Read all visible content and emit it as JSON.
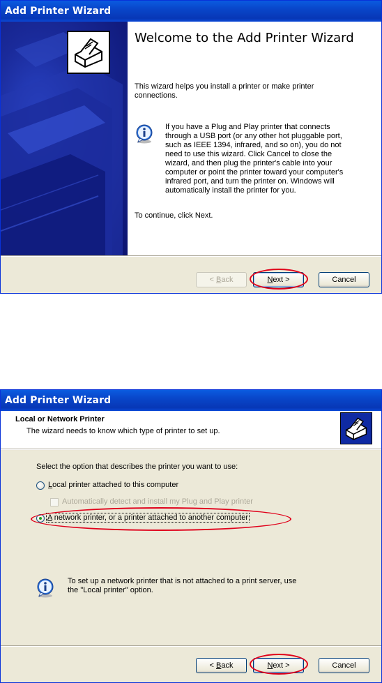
{
  "window1": {
    "title": "Add Printer Wizard",
    "welcome_heading": "Welcome to the Add Printer Wizard",
    "intro": "This wizard helps you install a printer or make printer connections.",
    "info": "If you have a Plug and Play printer that connects through a USB port (or any other hot pluggable port, such as IEEE 1394, infrared, and so on), you do not need to use this wizard. Click Cancel to close the wizard, and then plug the printer's cable into your computer or point the printer toward your computer's infrared port, and turn the printer on. Windows will automatically install the printer for you.",
    "continue_text": "To continue, click Next.",
    "back_label_rest": "ack",
    "back_prefix": "< ",
    "back_mnemonic": "B",
    "next_mnemonic": "N",
    "next_label_rest": "ext >",
    "cancel_label": "Cancel"
  },
  "window2": {
    "title": "Add Printer Wizard",
    "header_title": "Local or Network Printer",
    "header_subtitle": "The wizard needs to know which type of printer to set up.",
    "prompt": "Select the option that describes the printer you want to use:",
    "options": [
      {
        "mnemonic": "L",
        "rest": "ocal printer attached to this computer",
        "checked": false
      },
      {
        "mnemonic": "A",
        "rest": " network printer, or a printer attached to another computer",
        "checked": true
      }
    ],
    "auto_detect": "Automatically detect and install my Plug and Play printer",
    "info": "To set up a network printer that is not attached to a print server, use the \"Local printer\" option.",
    "back_prefix": "< ",
    "back_mnemonic": "B",
    "back_label_rest": "ack",
    "next_mnemonic": "N",
    "next_label_rest": "ext >",
    "cancel_label": "Cancel"
  },
  "icons": [
    "printer-icon",
    "info-icon"
  ],
  "colors": {
    "titlebar": "#0a4fd6",
    "dialog": "#ece9d8",
    "banner": "#1a2a9a",
    "highlight": "#e0001a"
  }
}
